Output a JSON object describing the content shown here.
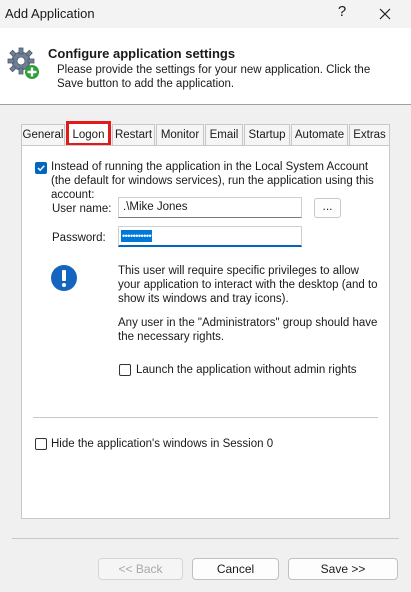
{
  "window": {
    "title": "Add Application",
    "help_glyph": "?"
  },
  "header": {
    "title": "Configure application settings",
    "description": "Please provide the settings for your new application. Click the Save button to add the application."
  },
  "tabs": [
    {
      "label": "General"
    },
    {
      "label": "Logon",
      "active": true
    },
    {
      "label": "Restart"
    },
    {
      "label": "Monitor"
    },
    {
      "label": "Email"
    },
    {
      "label": "Startup"
    },
    {
      "label": "Automate"
    },
    {
      "label": "Extras"
    }
  ],
  "logon": {
    "run_as_account_label": "Instead of running the application in the Local System Account (the default for windows services), run the application using this account:",
    "run_as_account_checked": true,
    "user_name_label": "User name:",
    "user_name_value": ".\\Mike Jones",
    "browse_label": "...",
    "password_label": "Password:",
    "password_mask": "•••••••••••",
    "info_text_1": "This user will require specific privileges to allow your application to interact with the desktop (and to show its windows and tray icons).",
    "info_text_2": "Any user in the \"Administrators\" group should have the necessary rights.",
    "launch_without_admin_label": "Launch the application without admin rights",
    "launch_without_admin_checked": false,
    "hide_windows_label": "Hide the application's windows in Session 0",
    "hide_windows_checked": false
  },
  "footer": {
    "back_label": "<< Back",
    "cancel_label": "Cancel",
    "save_label": "Save >>"
  },
  "colors": {
    "accent": "#0067c0",
    "highlight_box": "#e11b1b",
    "info_icon": "#1565c0"
  }
}
